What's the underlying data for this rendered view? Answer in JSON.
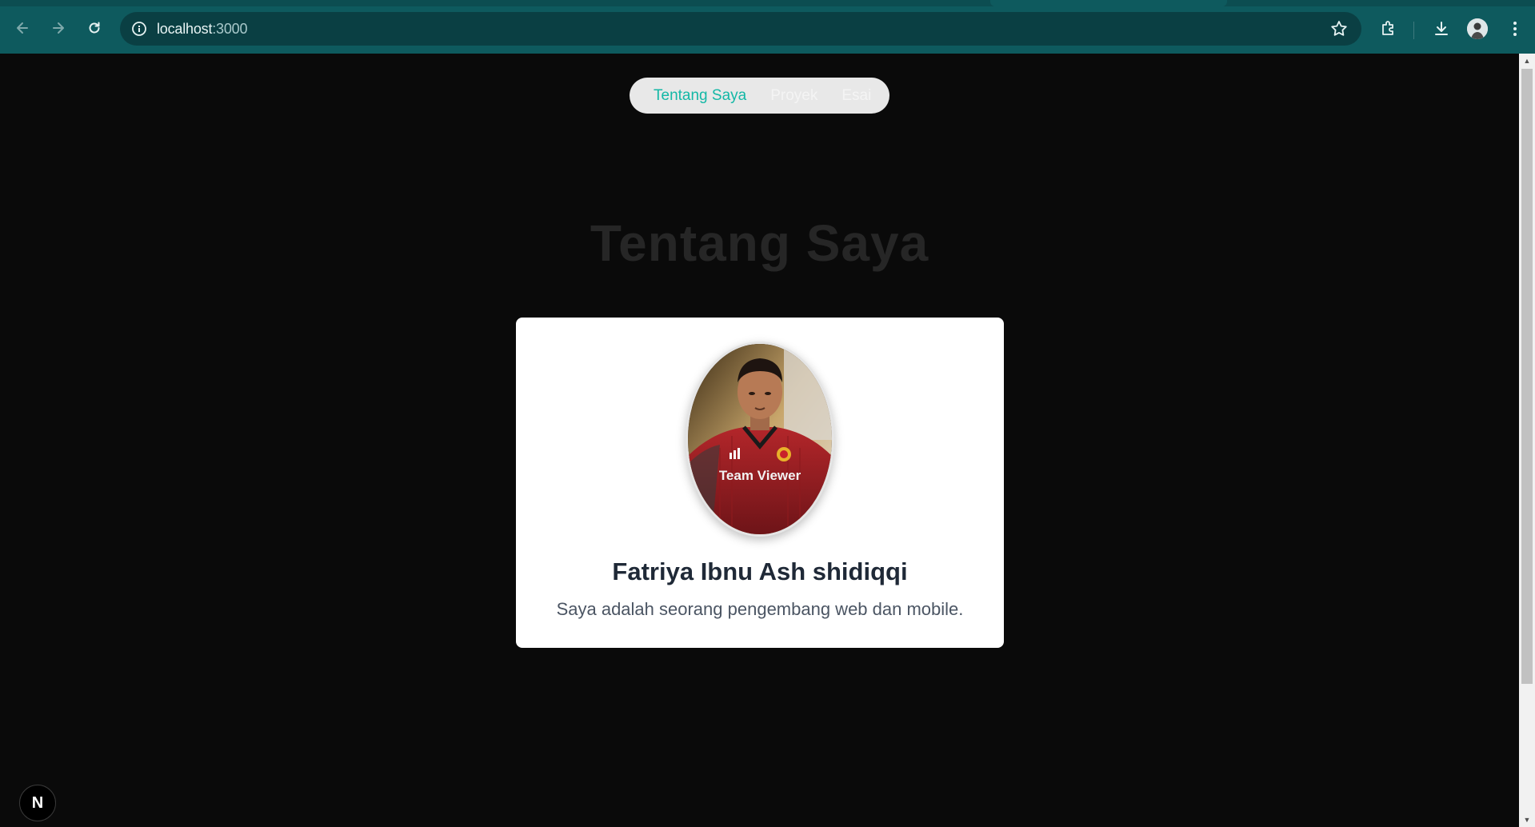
{
  "browser": {
    "url_host": "localhost",
    "url_port": ":3000"
  },
  "nav": {
    "items": [
      {
        "label": "Tentang Saya",
        "active": true
      },
      {
        "label": "Proyek",
        "active": false
      },
      {
        "label": "Esai",
        "active": false
      }
    ]
  },
  "section": {
    "title": "Tentang Saya"
  },
  "profile": {
    "name": "Fatriya Ibnu Ash shidiqqi",
    "description": "Saya adalah seorang pengembang web dan mobile.",
    "photo_sponsor_text": "Team Viewer"
  },
  "dev_indicator": {
    "label": "N"
  },
  "colors": {
    "accent": "#14b8a6",
    "chrome": "#0e5a5e",
    "page_bg": "#0a0a0a"
  }
}
